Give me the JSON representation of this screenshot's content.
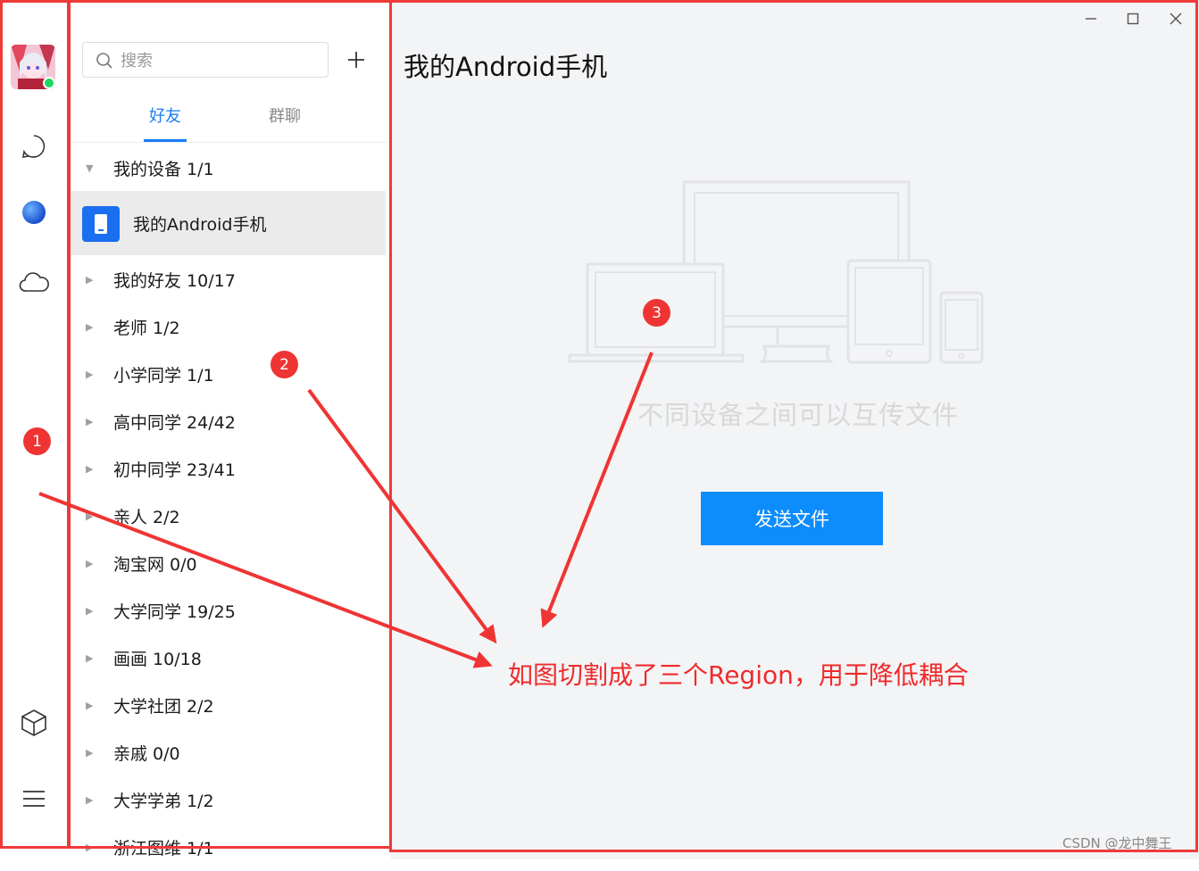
{
  "sidebar": {
    "icons": [
      "avatar",
      "chat-bubble-icon",
      "sphere-icon",
      "cloud-icon",
      "cube-icon",
      "menu-icon"
    ]
  },
  "contacts": {
    "search_placeholder": "搜索",
    "tabs": [
      {
        "label": "好友",
        "active": true
      },
      {
        "label": "群聊",
        "active": false
      }
    ],
    "device_group": {
      "label": "我的设备 1/1",
      "expanded": true
    },
    "device_item": "我的Android手机",
    "groups": [
      {
        "label": "我的好友 10/17"
      },
      {
        "label": "老师 1/2"
      },
      {
        "label": "小学同学 1/1"
      },
      {
        "label": "高中同学 24/42"
      },
      {
        "label": "初中同学 23/41"
      },
      {
        "label": "亲人 2/2"
      },
      {
        "label": "淘宝网 0/0"
      },
      {
        "label": "大学同学 19/25"
      },
      {
        "label": "画画 10/18"
      },
      {
        "label": "大学社团 2/2"
      },
      {
        "label": "亲戚 0/0"
      },
      {
        "label": "大学学弟 1/2"
      },
      {
        "label": "浙江图维 1/1"
      }
    ]
  },
  "main": {
    "title": "我的Android手机",
    "empty_text": "不同设备之间可以互传文件",
    "send_button": "发送文件"
  },
  "annotations": {
    "badges": [
      "1",
      "2",
      "3"
    ],
    "text": "如图切割成了三个Region，用于降低耦合"
  },
  "watermark": "CSDN @龙中舞王",
  "colors": {
    "accent": "#1a7cf5",
    "send_button": "#0d8cfc",
    "annotation": "#ef3434",
    "main_bg": "#f3f4f6",
    "selected_row": "#ebebeb"
  }
}
